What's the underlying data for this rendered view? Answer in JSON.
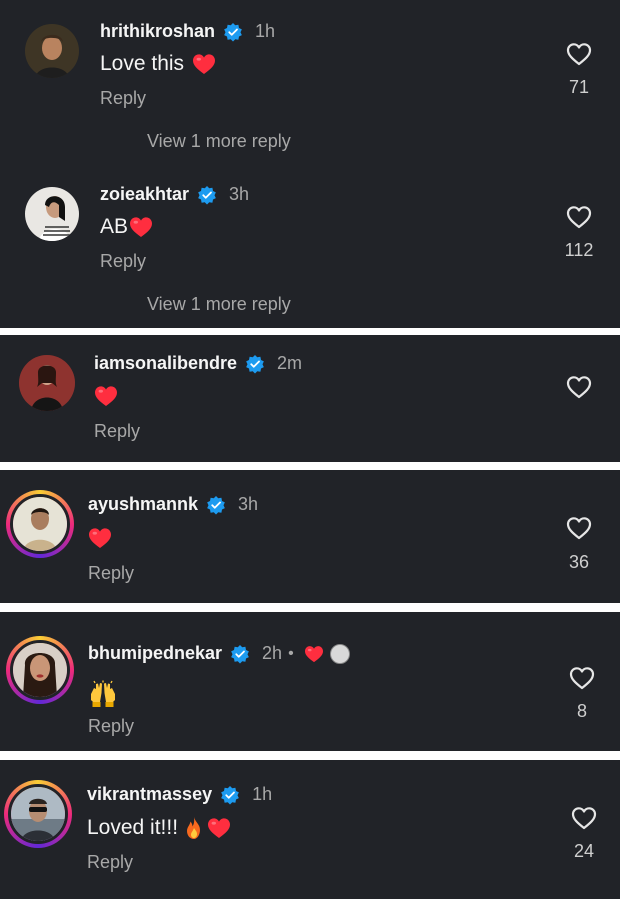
{
  "comments": [
    {
      "username": "hrithikroshan",
      "time": "1h",
      "text": "Love this",
      "reply": "Reply",
      "view_more": "View 1 more reply",
      "likes": "71"
    },
    {
      "username": "zoieakhtar",
      "time": "3h",
      "text": "AB",
      "reply": "Reply",
      "view_more": "View 1 more reply",
      "likes": "112"
    },
    {
      "username": "iamsonalibendre",
      "time": "2m",
      "text": "",
      "reply": "Reply",
      "likes": ""
    },
    {
      "username": "ayushmannk",
      "time": "3h",
      "text": "",
      "reply": "Reply",
      "likes": "36"
    },
    {
      "username": "bhumipednekar",
      "time": "2h",
      "separator": "•",
      "text": "",
      "reply": "Reply",
      "likes": "8"
    },
    {
      "username": "vikrantmassey",
      "time": "1h",
      "text": "Loved it!!!",
      "reply": "Reply",
      "likes": "24"
    }
  ],
  "icons": {
    "verified": "verified-badge-icon",
    "like": "heart-outline-icon",
    "heart_emoji": "red-heart-emoji",
    "fire_emoji": "fire-emoji",
    "hands_emoji": "raised-hands-emoji"
  },
  "colors": {
    "background": "#212328",
    "separator": "#ffffff",
    "verified": "#1d9bf0",
    "heart": "#ff2e3f",
    "muted": "#a8a8a8"
  }
}
